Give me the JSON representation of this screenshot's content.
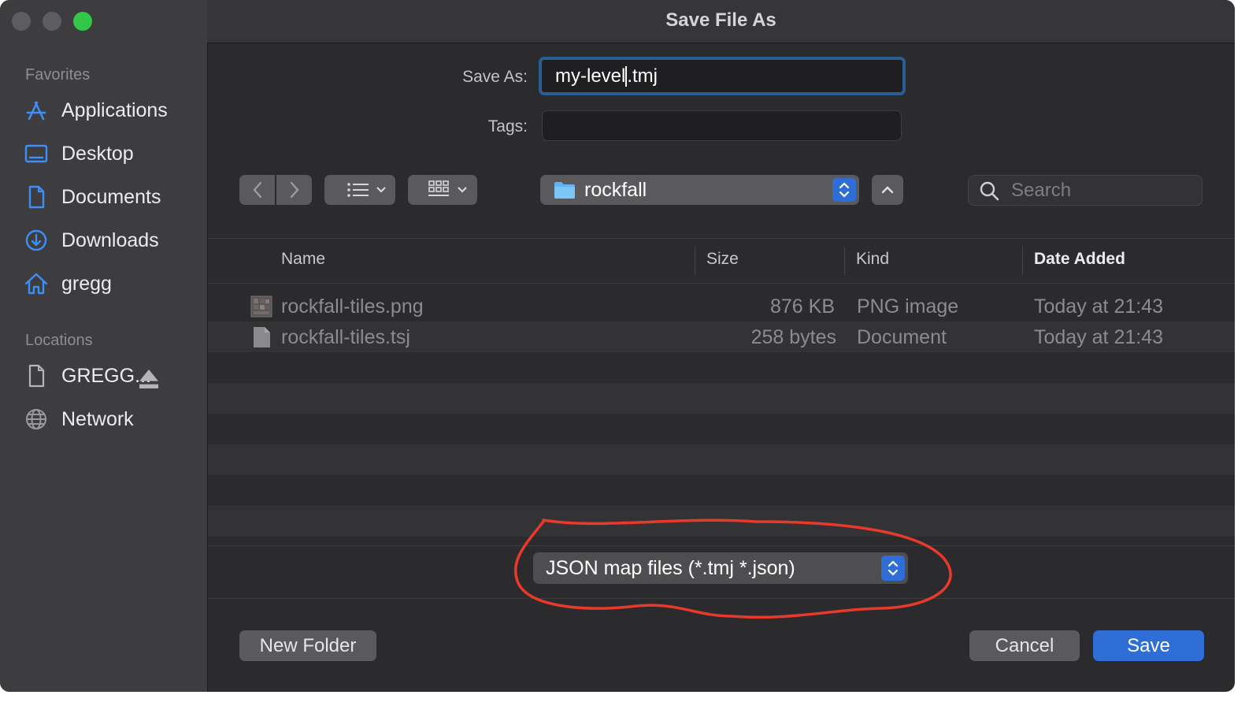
{
  "window": {
    "title": "Save File As"
  },
  "sidebar": {
    "favorites_heading": "Favorites",
    "favorites": [
      {
        "label": "Applications",
        "icon": "applications-icon"
      },
      {
        "label": "Desktop",
        "icon": "desktop-icon"
      },
      {
        "label": "Documents",
        "icon": "document-icon"
      },
      {
        "label": "Downloads",
        "icon": "download-icon"
      },
      {
        "label": "gregg",
        "icon": "home-icon"
      }
    ],
    "locations_heading": "Locations",
    "locations": [
      {
        "label": "GREGG...",
        "icon": "drive-icon"
      },
      {
        "label": "Network",
        "icon": "globe-icon"
      }
    ]
  },
  "form": {
    "save_as_label": "Save As:",
    "filename_before_caret": "my-level",
    "filename_after_caret": ".tmj",
    "tags_label": "Tags:",
    "tags_value": ""
  },
  "toolbar": {
    "location": "rockfall",
    "search_placeholder": "Search"
  },
  "table": {
    "columns": [
      "Name",
      "Size",
      "Kind",
      "Date Added"
    ],
    "sorted_column": "Date Added",
    "rows": [
      {
        "name": "rockfall-tiles.png",
        "size": "876 KB",
        "kind": "PNG image",
        "date": "Today at 21:43",
        "icon": "image-file-icon"
      },
      {
        "name": "rockfall-tiles.tsj",
        "size": "258 bytes",
        "kind": "Document",
        "date": "Today at 21:43",
        "icon": "file-icon"
      }
    ]
  },
  "format_popup": {
    "value": "JSON map files (*.tmj *.json)"
  },
  "buttons": {
    "new_folder": "New Folder",
    "cancel": "Cancel",
    "save": "Save"
  },
  "colors": {
    "accent": "#2f6ed6",
    "annotation": "#e8392b",
    "sidebar_icon": "#3d8ef7"
  }
}
